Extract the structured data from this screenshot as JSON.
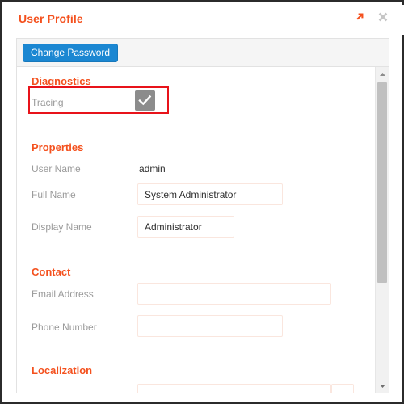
{
  "window": {
    "title": "User Profile",
    "expand_icon": "expand-arrow-icon",
    "close_icon": "close-icon",
    "accent_color": "#f4511e",
    "highlight_color": "#e8131a"
  },
  "toolbar": {
    "change_password_label": "Change Password",
    "button_color": "#1b87d2"
  },
  "sections": {
    "diagnostics": {
      "title": "Diagnostics",
      "tracing_label": "Tracing",
      "tracing_checked": true,
      "tracing_checkbox_color": "#8c8c8c"
    },
    "properties": {
      "title": "Properties",
      "user_name_label": "User Name",
      "user_name_value": "admin",
      "full_name_label": "Full Name",
      "full_name_value": "System Administrator",
      "display_name_label": "Display Name",
      "display_name_value": "Administrator"
    },
    "contact": {
      "title": "Contact",
      "email_label": "Email Address",
      "email_value": "",
      "email_placeholder": "",
      "phone_label": "Phone Number",
      "phone_value": "",
      "phone_placeholder": ""
    },
    "localization": {
      "title": "Localization"
    }
  }
}
